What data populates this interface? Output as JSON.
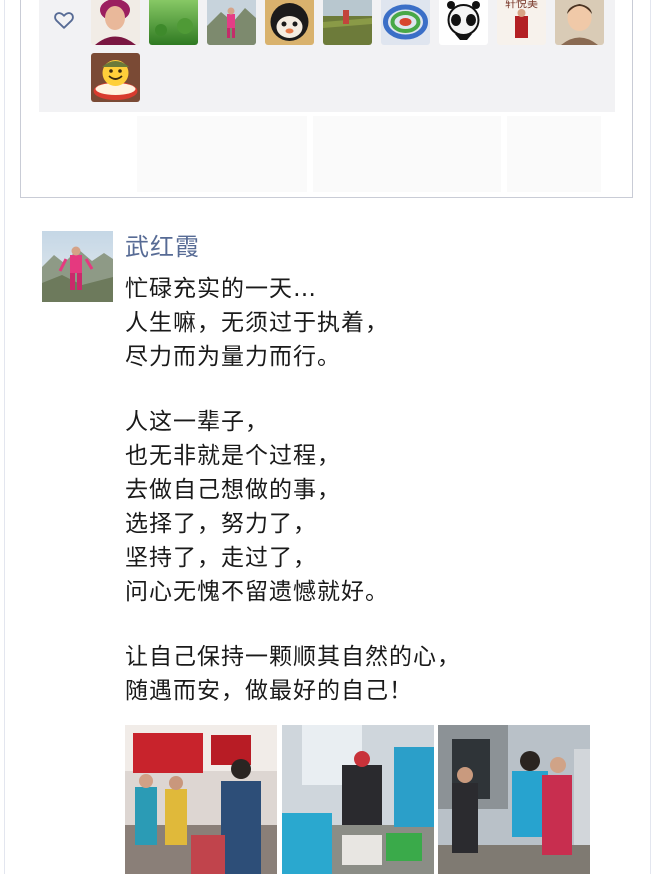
{
  "likes_section": {
    "heart_icon": "heart-outline-icon",
    "likers": [
      {
        "name": "liker-1",
        "kind": "portrait-red-hair"
      },
      {
        "name": "liker-2",
        "kind": "green-field"
      },
      {
        "name": "liker-3",
        "kind": "mountain-hiker"
      },
      {
        "name": "liker-4",
        "kind": "cartoon-face"
      },
      {
        "name": "liker-5",
        "kind": "crop-field"
      },
      {
        "name": "liker-6",
        "kind": "colorful-ring"
      },
      {
        "name": "liker-7",
        "kind": "panda-cartoon"
      },
      {
        "name": "liker-8",
        "kind": "calligraphy-portrait",
        "overlay_text": "轩悦美"
      },
      {
        "name": "liker-9",
        "kind": "child-portrait"
      },
      {
        "name": "liker-10",
        "kind": "smiley-cake"
      }
    ]
  },
  "post": {
    "author": "武红霞",
    "author_color": "#576b95",
    "paragraphs": [
      [
        "忙碌充实的一天…",
        "人生嘛，无须过于执着，",
        "尽力而为量力而行。"
      ],
      [
        "人这一辈子，",
        "也无非就是个过程，",
        "去做自己想做的事，",
        "选择了，努力了，",
        "坚持了，走过了，",
        "问心无愧不留遗憾就好。"
      ],
      [
        "让自己保持一颗顺其自然的心，",
        "随遇而安，做最好的自己！"
      ]
    ],
    "photos": [
      {
        "name": "photo-1",
        "scene": "indoor-meeting-red-wall"
      },
      {
        "name": "photo-2",
        "scene": "indoor-supplies"
      },
      {
        "name": "photo-3",
        "scene": "outdoor-hug"
      }
    ]
  }
}
